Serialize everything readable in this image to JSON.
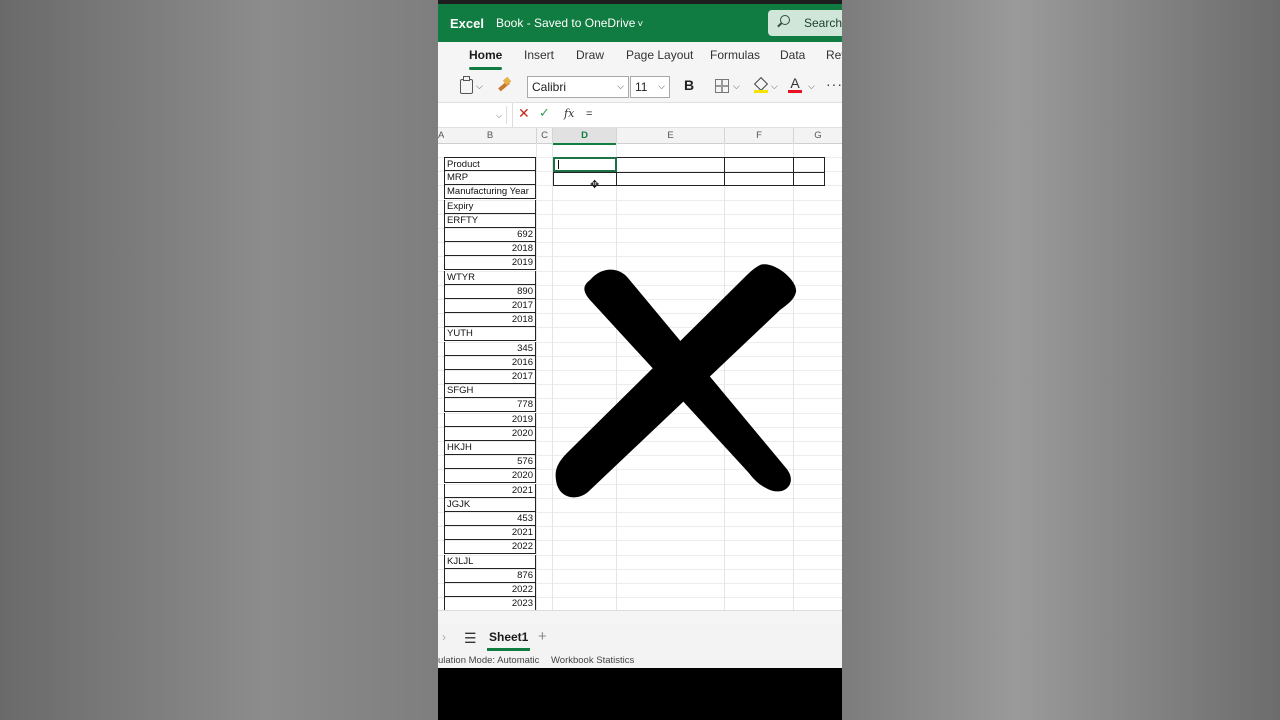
{
  "app": {
    "name": "Excel",
    "doc_title": "Book",
    "save_status": "Saved to OneDrive",
    "search_label": "Search ("
  },
  "ribbon": {
    "tabs": [
      {
        "label": "Home",
        "active": true
      },
      {
        "label": "Insert"
      },
      {
        "label": "Draw"
      },
      {
        "label": "Page Layout"
      },
      {
        "label": "Formulas"
      },
      {
        "label": "Data"
      },
      {
        "label": "Rev"
      }
    ],
    "font_name": "Calibri",
    "font_size": "11",
    "bold_label": "B",
    "font_color_glyph": "A",
    "more_label": "···",
    "accent_color": "#107c41",
    "fill_color": "#f6e400",
    "font_color": "#e81123"
  },
  "formula_bar": {
    "fx_label": "fx",
    "formula": "="
  },
  "grid": {
    "columns": [
      "A",
      "B",
      "C",
      "D",
      "E",
      "F",
      "G"
    ],
    "active_column": "D",
    "column_b_cells": [
      {
        "text": "Product",
        "align": "left"
      },
      {
        "text": "MRP",
        "align": "left"
      },
      {
        "text": "Manufacturing Year",
        "align": "left"
      },
      {
        "text": "Expiry",
        "align": "left"
      },
      {
        "text": "ERFTY",
        "align": "left"
      },
      {
        "text": "692",
        "align": "right"
      },
      {
        "text": "2018",
        "align": "right"
      },
      {
        "text": "2019",
        "align": "right"
      },
      {
        "text": "WTYR",
        "align": "left"
      },
      {
        "text": "890",
        "align": "right"
      },
      {
        "text": "2017",
        "align": "right"
      },
      {
        "text": "2018",
        "align": "right"
      },
      {
        "text": "YUTH",
        "align": "left"
      },
      {
        "text": "345",
        "align": "right"
      },
      {
        "text": "2016",
        "align": "right"
      },
      {
        "text": "2017",
        "align": "right"
      },
      {
        "text": "SFGH",
        "align": "left"
      },
      {
        "text": "778",
        "align": "right"
      },
      {
        "text": "2019",
        "align": "right"
      },
      {
        "text": "2020",
        "align": "right"
      },
      {
        "text": "HKJH",
        "align": "left"
      },
      {
        "text": "576",
        "align": "right"
      },
      {
        "text": "2020",
        "align": "right"
      },
      {
        "text": "2021",
        "align": "right"
      },
      {
        "text": "JGJK",
        "align": "left"
      },
      {
        "text": "453",
        "align": "right"
      },
      {
        "text": "2021",
        "align": "right"
      },
      {
        "text": "2022",
        "align": "right"
      },
      {
        "text": "KJLJL",
        "align": "left"
      },
      {
        "text": "876",
        "align": "right"
      },
      {
        "text": "2022",
        "align": "right"
      },
      {
        "text": "2023",
        "align": "right"
      }
    ],
    "selected_cell_value": "="
  },
  "sheets": {
    "tabs": [
      "Sheet1"
    ],
    "active": "Sheet1",
    "add_label": "+"
  },
  "status": {
    "calc_mode": "ulation Mode: Automatic",
    "workbook_stats": "Workbook Statistics"
  }
}
